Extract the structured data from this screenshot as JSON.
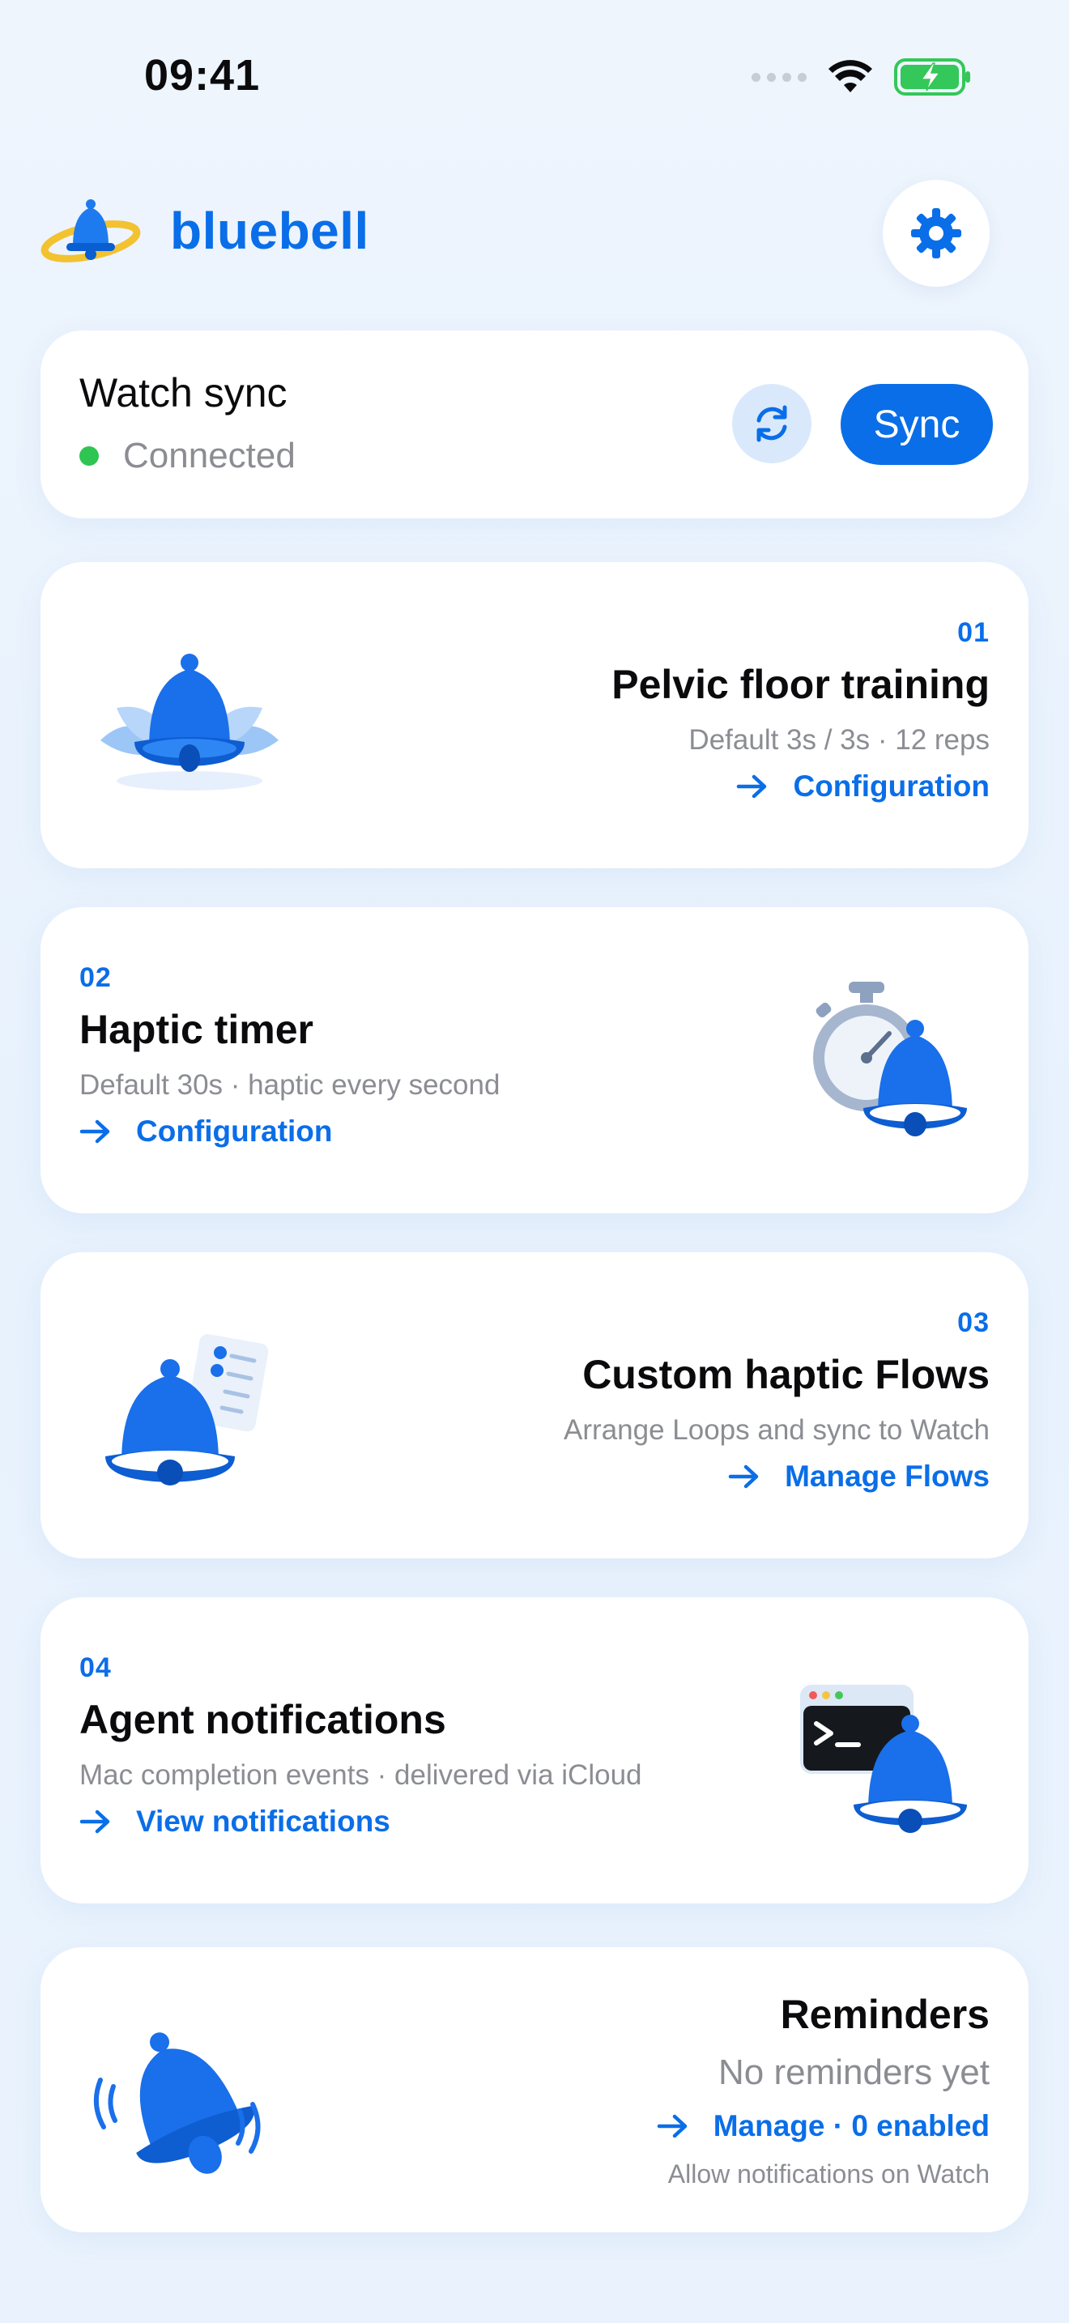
{
  "status_bar": {
    "time": "09:41"
  },
  "header": {
    "brand": "bluebell"
  },
  "watch_sync": {
    "title": "Watch sync",
    "status": "Connected",
    "sync_label": "Sync"
  },
  "features": [
    {
      "number": "01",
      "title": "Pelvic floor training",
      "subtitle": "Default 3s / 3s · 12 reps",
      "link": "Configuration"
    },
    {
      "number": "02",
      "title": "Haptic timer",
      "subtitle": "Default 30s · haptic every second",
      "link": "Configuration"
    },
    {
      "number": "03",
      "title": "Custom haptic Flows",
      "subtitle": "Arrange Loops and sync to Watch",
      "link": "Manage Flows"
    },
    {
      "number": "04",
      "title": "Agent notifications",
      "subtitle": "Mac completion events · delivered via iCloud",
      "link": "View notifications"
    }
  ],
  "reminders": {
    "title": "Reminders",
    "subtitle": "No reminders yet",
    "link": "Manage · 0 enabled",
    "note": "Allow notifications on Watch"
  },
  "colors": {
    "accent": "#0A6EE8",
    "connected": "#2FC553",
    "battery": "#34C759"
  }
}
